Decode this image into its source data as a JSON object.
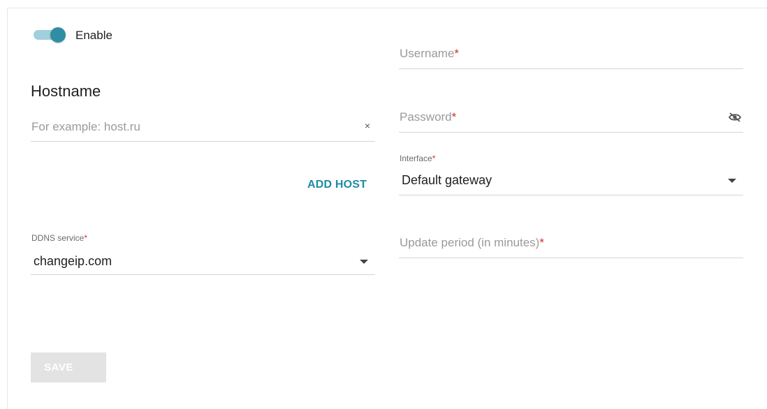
{
  "enable": {
    "label": "Enable",
    "state": "on"
  },
  "hostname": {
    "title": "Hostname",
    "placeholder": "For example: host.ru",
    "clear_glyph": "×",
    "add_host_label": "ADD HOST"
  },
  "ddns_service": {
    "label": "DDNS service",
    "required_mark": "*",
    "value": "changeip.com"
  },
  "username": {
    "placeholder": "Username",
    "required_mark": "*"
  },
  "password": {
    "placeholder": "Password",
    "required_mark": "*"
  },
  "interface": {
    "label": "Interface",
    "required_mark": "*",
    "value": "Default gateway"
  },
  "update_period": {
    "placeholder": "Update period (in minutes)",
    "required_mark": "*"
  },
  "save": {
    "label": "SAVE",
    "state": "disabled"
  },
  "colors": {
    "accent": "#2f8ea3",
    "link": "#1e8ba3",
    "required": "#d32f2f",
    "disabled_button": "#e3e3e3"
  }
}
